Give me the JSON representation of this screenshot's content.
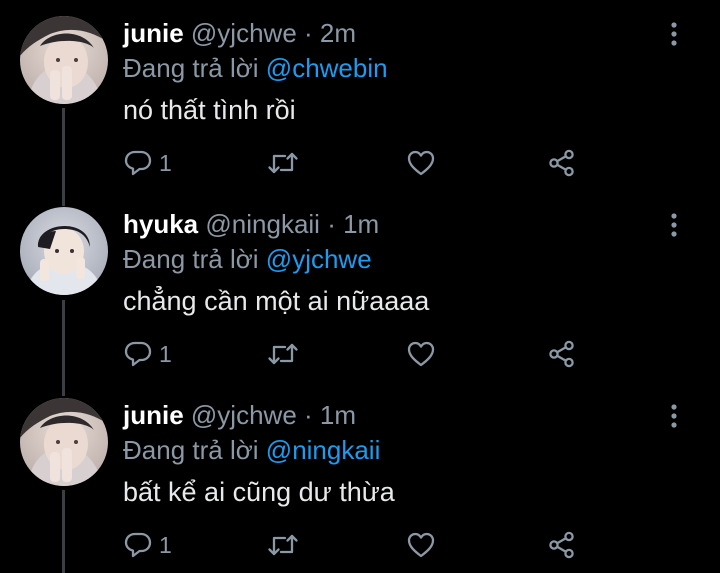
{
  "colors": {
    "background": "#000000",
    "primary_text": "#e7e9ea",
    "secondary_text": "#8b98a5",
    "mention": "#1d9bf0",
    "thread_line": "#3a3f44"
  },
  "icons": {
    "reply": "reply-icon",
    "retweet": "retweet-icon",
    "like": "heart-icon",
    "share": "share-icon",
    "more": "more-vertical-icon"
  },
  "tweets": [
    {
      "display_name": "junie",
      "handle": "@yjchwe",
      "separator": "·",
      "time": "2m",
      "reply_prefix": "Đang trả lời",
      "reply_to": "@chwebin",
      "text": "nó thất tình rồi",
      "reply_count": "1"
    },
    {
      "display_name": "hyuka",
      "handle": "@ningkaii",
      "separator": "·",
      "time": "1m",
      "reply_prefix": "Đang trả lời",
      "reply_to": "@yjchwe",
      "text": "chẳng cần một ai nữaaaa",
      "reply_count": "1"
    },
    {
      "display_name": "junie",
      "handle": "@yjchwe",
      "separator": "·",
      "time": "1m",
      "reply_prefix": "Đang trả lời",
      "reply_to": "@ningkaii",
      "text": "bất kể ai cũng dư thừa",
      "reply_count": "1"
    }
  ]
}
